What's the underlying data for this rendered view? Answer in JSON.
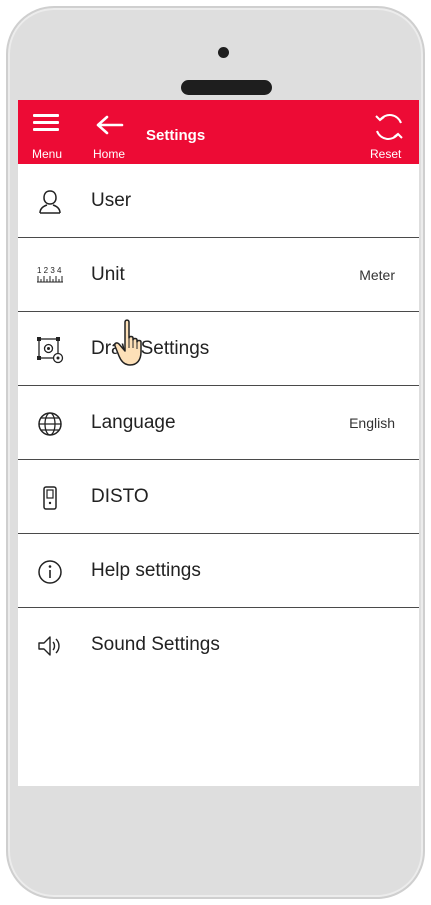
{
  "topbar": {
    "menu_label": "Menu",
    "home_label": "Home",
    "title": "Settings",
    "reset_label": "Reset",
    "color": "#ed0b35"
  },
  "settings": {
    "items": [
      {
        "label": "User",
        "value": "",
        "icon": "user-icon"
      },
      {
        "label": "Unit",
        "value": "Meter",
        "icon": "ruler-icon"
      },
      {
        "label": "Draw Settings",
        "value": "",
        "icon": "draw-settings-icon"
      },
      {
        "label": "Language",
        "value": "English",
        "icon": "globe-icon"
      },
      {
        "label": "DISTO",
        "value": "",
        "icon": "disto-device-icon"
      },
      {
        "label": "Help settings",
        "value": "",
        "icon": "info-icon"
      },
      {
        "label": "Sound Settings",
        "value": "",
        "icon": "speaker-icon"
      }
    ]
  },
  "cursor": {
    "icon": "hand-pointer-icon"
  }
}
